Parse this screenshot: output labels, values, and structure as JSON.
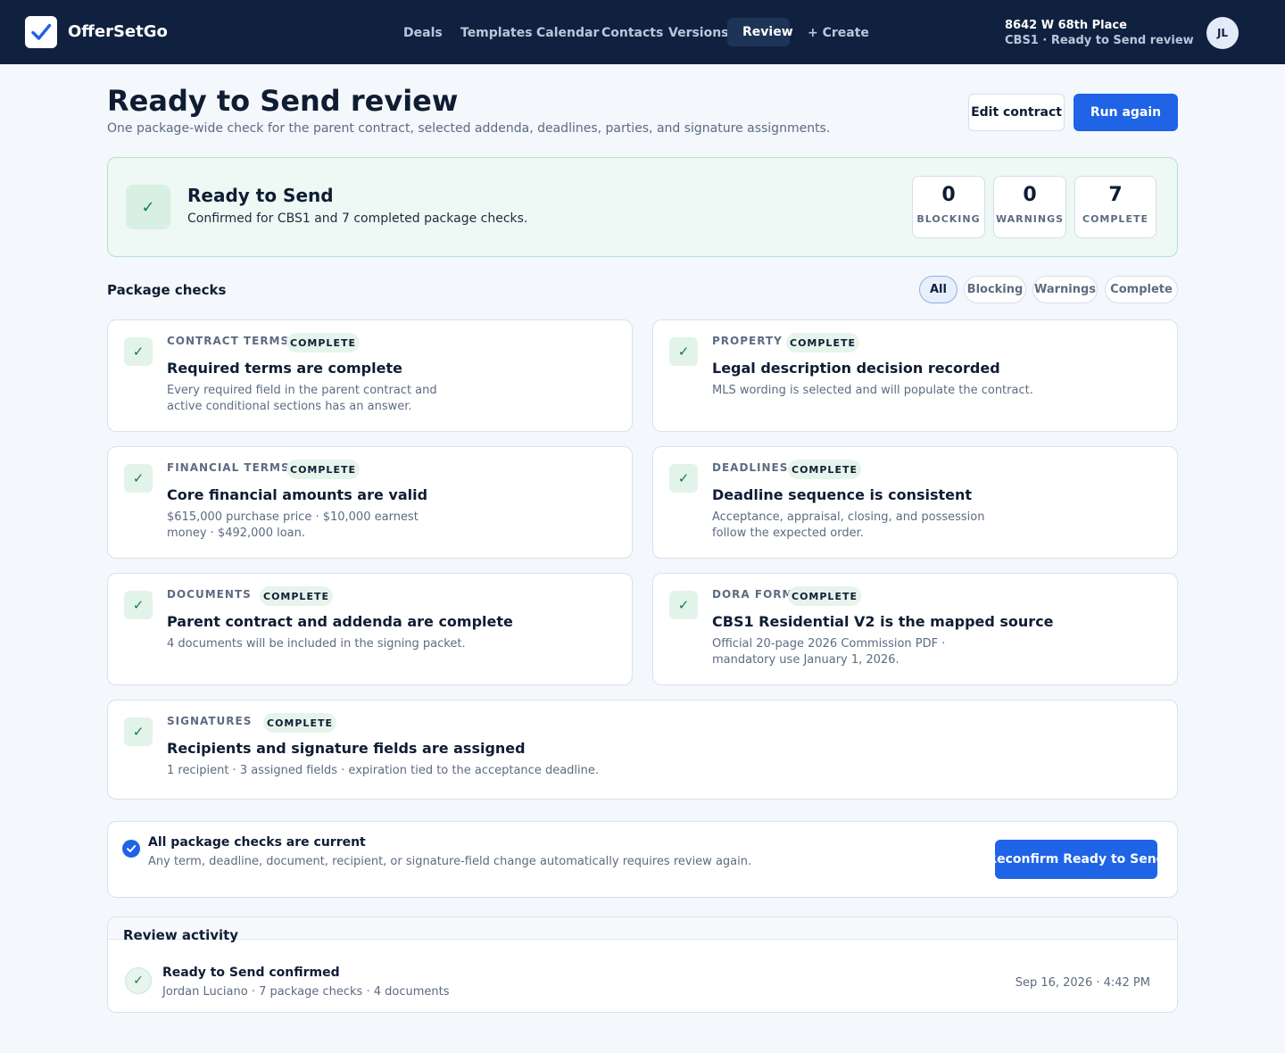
{
  "app": {
    "name": "OfferSetGo"
  },
  "nav": {
    "items": [
      "Deals",
      "Templates",
      "Calendar",
      "Contacts",
      "Versions",
      "Review",
      "+ Create"
    ],
    "active": "Review"
  },
  "deal": {
    "address": "8642 W 68th Place",
    "subtitle": "CBS1 · Ready to Send review"
  },
  "user": {
    "initials": "JL"
  },
  "header": {
    "title": "Ready to Send review",
    "subtitle": "One package-wide check for the parent contract, selected addenda, deadlines, parties, and signature assignments.",
    "edit_label": "Edit contract",
    "run_label": "Run again"
  },
  "status": {
    "title": "Ready to Send",
    "description": "Confirmed for CBS1 and 7 completed package checks.",
    "stats": [
      {
        "value": "0",
        "label": "BLOCKING"
      },
      {
        "value": "0",
        "label": "WARNINGS"
      },
      {
        "value": "7",
        "label": "COMPLETE"
      }
    ]
  },
  "checks_section": {
    "title": "Package checks",
    "filters": [
      "All",
      "Blocking",
      "Warnings",
      "Complete"
    ],
    "active_filter": "All"
  },
  "checks": [
    {
      "category": "CONTRACT TERMS",
      "badge": "COMPLETE",
      "title": "Required terms are complete",
      "description": "Every required field in the parent contract and active conditional sections has an answer."
    },
    {
      "category": "PROPERTY",
      "badge": "COMPLETE",
      "title": "Legal description decision recorded",
      "description": "MLS wording is selected and will populate the contract."
    },
    {
      "category": "FINANCIAL TERMS",
      "badge": "COMPLETE",
      "title": "Core financial amounts are valid",
      "description": "$615,000 purchase price · $10,000 earnest money · $492,000 loan."
    },
    {
      "category": "DEADLINES",
      "badge": "COMPLETE",
      "title": "Deadline sequence is consistent",
      "description": "Acceptance, appraisal, closing, and possession follow the expected order."
    },
    {
      "category": "DOCUMENTS",
      "badge": "COMPLETE",
      "title": "Parent contract and addenda are complete",
      "description": "4 documents will be included in the signing packet."
    },
    {
      "category": "DORA FORM",
      "badge": "COMPLETE",
      "title": "CBS1 Residential V2 is the mapped source",
      "description": "Official 20-page 2026 Commission PDF · mandatory use January 1, 2026."
    },
    {
      "category": "SIGNATURES",
      "badge": "COMPLETE",
      "title": "Recipients and signature fields are assigned",
      "description": "1 recipient · 3 assigned fields · expiration tied to the acceptance deadline."
    }
  ],
  "current": {
    "title": "All package checks are current",
    "description": "Any term, deadline, document, recipient, or signature-field change automatically requires review again.",
    "button_label": "Reconfirm Ready to Send"
  },
  "activity": {
    "title": "Review activity",
    "items": [
      {
        "event": "Ready to Send confirmed",
        "meta": "Jordan Luciano · 7 package checks · 4 documents",
        "time": "Sep 16, 2026 · 4:42 PM"
      }
    ]
  },
  "colors": {
    "navy": "#10213f",
    "accent": "#1f63e6",
    "success": "#17794d",
    "success_bg": "#eef8f4"
  }
}
